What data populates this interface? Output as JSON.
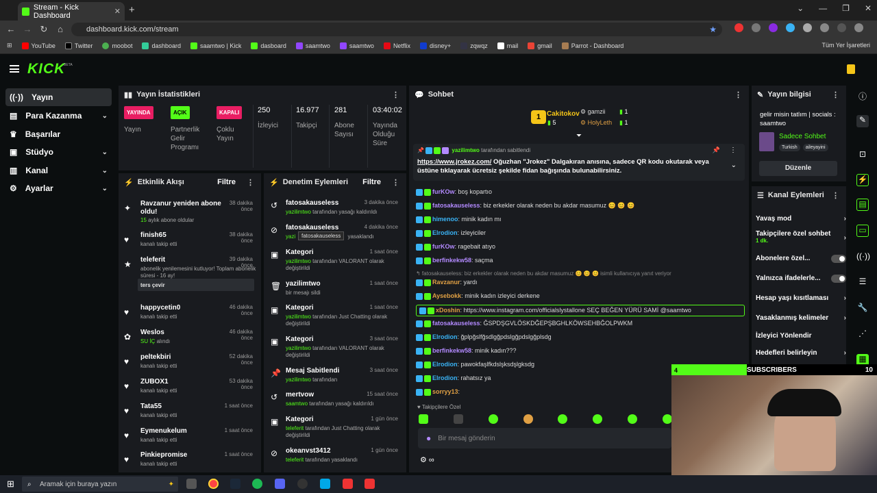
{
  "browser": {
    "tab_title": "Stream - Kick Dashboard",
    "url": "dashboard.kick.com/stream",
    "bookmarks": [
      "YouTube",
      "Twitter",
      "moobot",
      "dashboard",
      "saamtwo | Kick",
      "dasboard",
      "saamtwo",
      "saamtwo",
      "Netflix",
      "disney+",
      "zqwqz",
      "mail",
      "gmail",
      "Parrot - Dashboard"
    ],
    "bookmarks_right": "Tüm Yer İşaretleri"
  },
  "kick": {
    "logo": "KICK",
    "beta": "BETA"
  },
  "sidebar": {
    "items": [
      {
        "label": "Yayın",
        "icon": "broadcast-icon",
        "chev": ""
      },
      {
        "label": "Para Kazanma",
        "icon": "money-icon",
        "chev": "⌄"
      },
      {
        "label": "Başarılar",
        "icon": "trophy-icon",
        "chev": ""
      },
      {
        "label": "Stüdyo",
        "icon": "studio-icon",
        "chev": "⌄"
      },
      {
        "label": "Kanal",
        "icon": "channel-icon",
        "chev": "⌄"
      },
      {
        "label": "Ayarlar",
        "icon": "gear-icon",
        "chev": "⌄"
      }
    ]
  },
  "stats": {
    "title": "Yayın İstatistikleri",
    "items": [
      {
        "badge": "YAYINDA",
        "label": "Yayın",
        "color": "#e91e63"
      },
      {
        "badge": "AÇIK",
        "label": "Partnerlik Gelir Programı",
        "color": "#53fc18"
      },
      {
        "badge": "KAPALI",
        "label": "Çoklu Yayın",
        "color": "#e91e63"
      },
      {
        "num": "250",
        "label": "İzleyici"
      },
      {
        "num": "16.977",
        "label": "Takipçi"
      },
      {
        "num": "281",
        "label": "Abone Sayısı"
      },
      {
        "num": "03:40:02",
        "label": "Yayında Olduğu Süre"
      }
    ]
  },
  "feed": {
    "title": "Etkinlik Akışı",
    "filter": "Filtre",
    "rows": [
      {
        "name": "Ravzanur yeniden abone oldu!",
        "sub_green": "15",
        "sub": " aylık abone oldular",
        "time": "38 dakika önce"
      },
      {
        "name": "finish65",
        "sub_green": "",
        "sub": "kanalı takip etti",
        "time": "38 dakika önce"
      },
      {
        "name": "teleferit",
        "sub_green": "",
        "sub": "abonelik yenilemesini kutluyor! Toplam abonelik süresi - 16 ay!",
        "time": "39 dakika önce"
      },
      {
        "name": "happycetin0",
        "sub_green": "",
        "sub": "kanalı takip etti",
        "time": "46 dakika önce"
      },
      {
        "name": "Weslos",
        "sub_green": "SU İÇ",
        "sub": " alındı",
        "time": "46 dakika önce"
      },
      {
        "name": "peltekbiri",
        "sub_green": "",
        "sub": "kanalı takip etti",
        "time": "52 dakika önce"
      },
      {
        "name": "ZUBOX1",
        "sub_green": "",
        "sub": "kanalı takip etti",
        "time": "53 dakika önce"
      },
      {
        "name": "Tata55",
        "sub_green": "",
        "sub": "kanalı takip etti",
        "time": "1 saat önce"
      },
      {
        "name": "Eymenukelum",
        "sub_green": "",
        "sub": "kanalı takip etti",
        "time": "1 saat önce"
      },
      {
        "name": "Pinkiepromise",
        "sub_green": "",
        "sub": "kanalı takip etti",
        "time": "1 saat önce"
      }
    ],
    "reverse": "ters çevir"
  },
  "mod": {
    "title": "Denetim Eylemleri",
    "filter": "Filtre",
    "tooltip": "fatosakauseless",
    "rows": [
      {
        "name": "fatosakauseless",
        "sub_green": "yazilimtwo",
        "sub": " tarafından yasağı kaldırıldı",
        "time": "3 dakika önce"
      },
      {
        "name": "fatosakauseless",
        "sub_green": "yazi",
        "sub": " yasaklandı",
        "time": "4 dakika önce"
      },
      {
        "name": "Kategori",
        "sub_green": "yazilimtwo",
        "sub": " tarafından VALORANT olarak değiştirildi",
        "time": "1 saat önce"
      },
      {
        "name": "yazilimtwo",
        "sub_green": "",
        "sub": "bir mesajı sildi",
        "time": "1 saat önce"
      },
      {
        "name": "Kategori",
        "sub_green": "yazilimtwo",
        "sub": " tarafından Just Chatting olarak değiştirildi",
        "time": "1 saat önce"
      },
      {
        "name": "Kategori",
        "sub_green": "yazilimtwo",
        "sub": " tarafından VALORANT olarak değiştirildi",
        "time": "3 saat önce"
      },
      {
        "name": "Mesaj Sabitlendi",
        "sub_green": "yazilimtwo",
        "sub": " tarafından",
        "time": "3 saat önce"
      },
      {
        "name": "mertvow",
        "sub_green": "saamtwo",
        "sub": " tarafından yasağı kaldırıldı",
        "time": "15 saat önce"
      },
      {
        "name": "Kategori",
        "sub_green": "teleferit",
        "sub": " tarafından Just Chatting olarak değiştirildi",
        "time": "1 gün önce"
      },
      {
        "name": "okeanvst3412",
        "sub_green": "teleferit",
        "sub": " tarafından yasaklandı",
        "time": "1 gün önce"
      }
    ]
  },
  "chat": {
    "title": "Sohbet",
    "top_gifters": [
      {
        "rank": "1",
        "name": "Cakitokov",
        "count": "5"
      },
      {
        "name": "gamzii",
        "count": "1"
      },
      {
        "name": "HolyLeth",
        "count": "1"
      }
    ],
    "pinned": {
      "by": "yazilimtwo",
      "suffix": "tarafından sabitlendi",
      "link": "https://www.jrokez.com/",
      "text": " Oğuzhan \"Jrokez\" Dalgakıran anısına, sadece QR kodu okutarak veya üstüne tıklayarak ücretsiz şekilde fidan bağışında bulunabilirsiniz."
    },
    "messages": [
      {
        "user": "furKOw",
        "color": "#b38aff",
        "text": ": boş kopartıo"
      },
      {
        "user": "fatosakauseless",
        "color": "#b38aff",
        "text": ": biz erkekler olarak neden bu akdar masumuz 😊 😊 😊"
      },
      {
        "user": "himenoo",
        "color": "#3ab3f5",
        "text": ": minik kadın mı"
      },
      {
        "user": "Elrodion",
        "color": "#3ab3f5",
        "text": ":   izleyiciler"
      },
      {
        "user": "furKOw",
        "color": "#b38aff",
        "text": ": ragebait atıyo"
      },
      {
        "user": "berfinkekw58",
        "color": "#b38aff",
        "text": ": saçma"
      },
      {
        "user": "",
        "color": "#888",
        "text": "↰ fatosakauseless: biz erkekler olarak neden bu akdar masumuz 😊 😊 😊 isimli kullanıcıya yanıt veriyor"
      },
      {
        "user": "Ravzanur",
        "color": "#e0a044",
        "text": ": yardı"
      },
      {
        "user": "Aysebokk",
        "color": "#e0a044",
        "text": ": minik kadın izleyici derkene"
      },
      {
        "user": "xDoshin",
        "color": "#e0a044",
        "text": ": https://www.instagram.com/officialslystallone SEÇ BEĞEN YÜRÜ SAMİ @saamtwo"
      },
      {
        "user": "fatosakauseless",
        "color": "#b38aff",
        "text": ": ĞSPDŞGVLÖSKDĞEPŞBGHLKÖWSEHBĞOLPWKM"
      },
      {
        "user": "Elrodion",
        "color": "#3ab3f5",
        "text": ": ğplpğslfğsdlgğpdslgğpdslgğplsdg"
      },
      {
        "user": "berfinkekw58",
        "color": "#b38aff",
        "text": ": minik kadın???"
      },
      {
        "user": "Elrodion",
        "color": "#3ab3f5",
        "text": ": pawokfaşlfkdslşksdşlgksdg"
      },
      {
        "user": "Elrodion",
        "color": "#3ab3f5",
        "text": ": rahatsız ya"
      },
      {
        "user": "sorryy13",
        "color": "#e0a044",
        "text": ":"
      }
    ],
    "followers_only": "♥ Takipçilere Özel",
    "input_placeholder": "Bir mesaj gönderin"
  },
  "info": {
    "title": "Yayın bilgisi",
    "stream_title": "gelir misin tatlım | socials : saamtwo",
    "category": "Sadece Sohbet",
    "tags": [
      "Turkish",
      "aileyayini"
    ],
    "edit": "Düzenle"
  },
  "actions": {
    "title": "Kanal Eylemleri",
    "items": [
      {
        "label": "Yavaş mod",
        "kind": "chev",
        "sub": ""
      },
      {
        "label": "Takipçilere özel sohbet",
        "kind": "chev",
        "sub": "1 dk."
      },
      {
        "label": "Abonelere özel...",
        "kind": "toggle",
        "sub": ""
      },
      {
        "label": "Yalnızca ifadelerle...",
        "kind": "toggle",
        "sub": ""
      },
      {
        "label": "Hesap yaşı kısıtlaması",
        "kind": "chev",
        "sub": ""
      },
      {
        "label": "Yasaklanmış kelimeler",
        "kind": "chev",
        "sub": ""
      },
      {
        "label": "İzleyici Yönlendir",
        "kind": "none",
        "sub": ""
      },
      {
        "label": "Hedefleri belirleyin",
        "kind": "chev",
        "sub": ""
      }
    ]
  },
  "overlay": {
    "sub_count": "4",
    "sub_label": "SUBSCRIBERS",
    "sub_goal": "10"
  },
  "taskbar": {
    "search": "Aramak için buraya yazın"
  }
}
